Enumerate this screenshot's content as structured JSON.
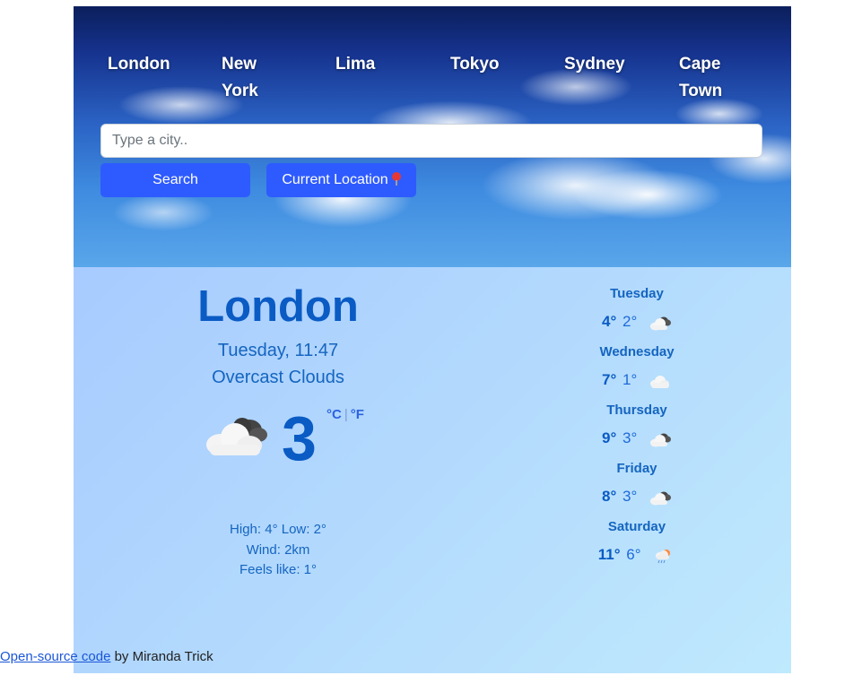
{
  "nav": {
    "cities": [
      "London",
      "New York",
      "Lima",
      "Tokyo",
      "Sydney",
      "Cape Town"
    ]
  },
  "search": {
    "placeholder": "Type a city..",
    "value": "",
    "search_label": "Search",
    "location_label": "Current Location",
    "location_icon": "pin-icon"
  },
  "current": {
    "city": "London",
    "datetime": "Tuesday, 11:47",
    "condition": "Overcast Clouds",
    "icon": "cloud-icon",
    "temperature": "3",
    "unit_c": "°C",
    "unit_sep": "|",
    "unit_f": "°F",
    "high_low": "High: 4° Low: 2°",
    "wind": "Wind: 2km",
    "feels_like": "Feels like: 1°"
  },
  "forecast": [
    {
      "day": "Tuesday",
      "high": "4°",
      "low": "2°",
      "icon": "broken-clouds-icon"
    },
    {
      "day": "Wednesday",
      "high": "7°",
      "low": "1°",
      "icon": "cloud-icon"
    },
    {
      "day": "Thursday",
      "high": "9°",
      "low": "3°",
      "icon": "broken-clouds-icon"
    },
    {
      "day": "Friday",
      "high": "8°",
      "low": "3°",
      "icon": "broken-clouds-icon"
    },
    {
      "day": "Saturday",
      "high": "11°",
      "low": "6°",
      "icon": "rain-icon"
    }
  ],
  "footer": {
    "link_text": "Open-source code",
    "by_text": " by Miranda Trick"
  },
  "colors": {
    "accent": "#2e5bff",
    "primary_text": "#0a5bc4"
  }
}
